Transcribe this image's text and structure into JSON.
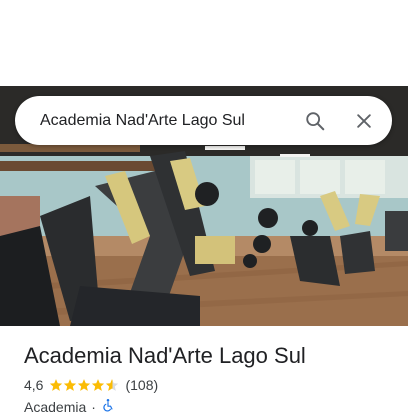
{
  "search": {
    "query": "Academia Nad'Arte Lago Sul",
    "search_icon": "search-icon",
    "close_icon": "close-icon"
  },
  "place": {
    "name": "Academia Nad'Arte Lago Sul",
    "rating": "4,6",
    "rating_value": 4.6,
    "review_count": "(108)",
    "category": "Academia",
    "separator": "·",
    "accessibility_icon": "wheelchair-icon"
  },
  "colors": {
    "star": "#fbbc04",
    "accessibility_blue": "#1a73e8",
    "text": "#202124"
  }
}
